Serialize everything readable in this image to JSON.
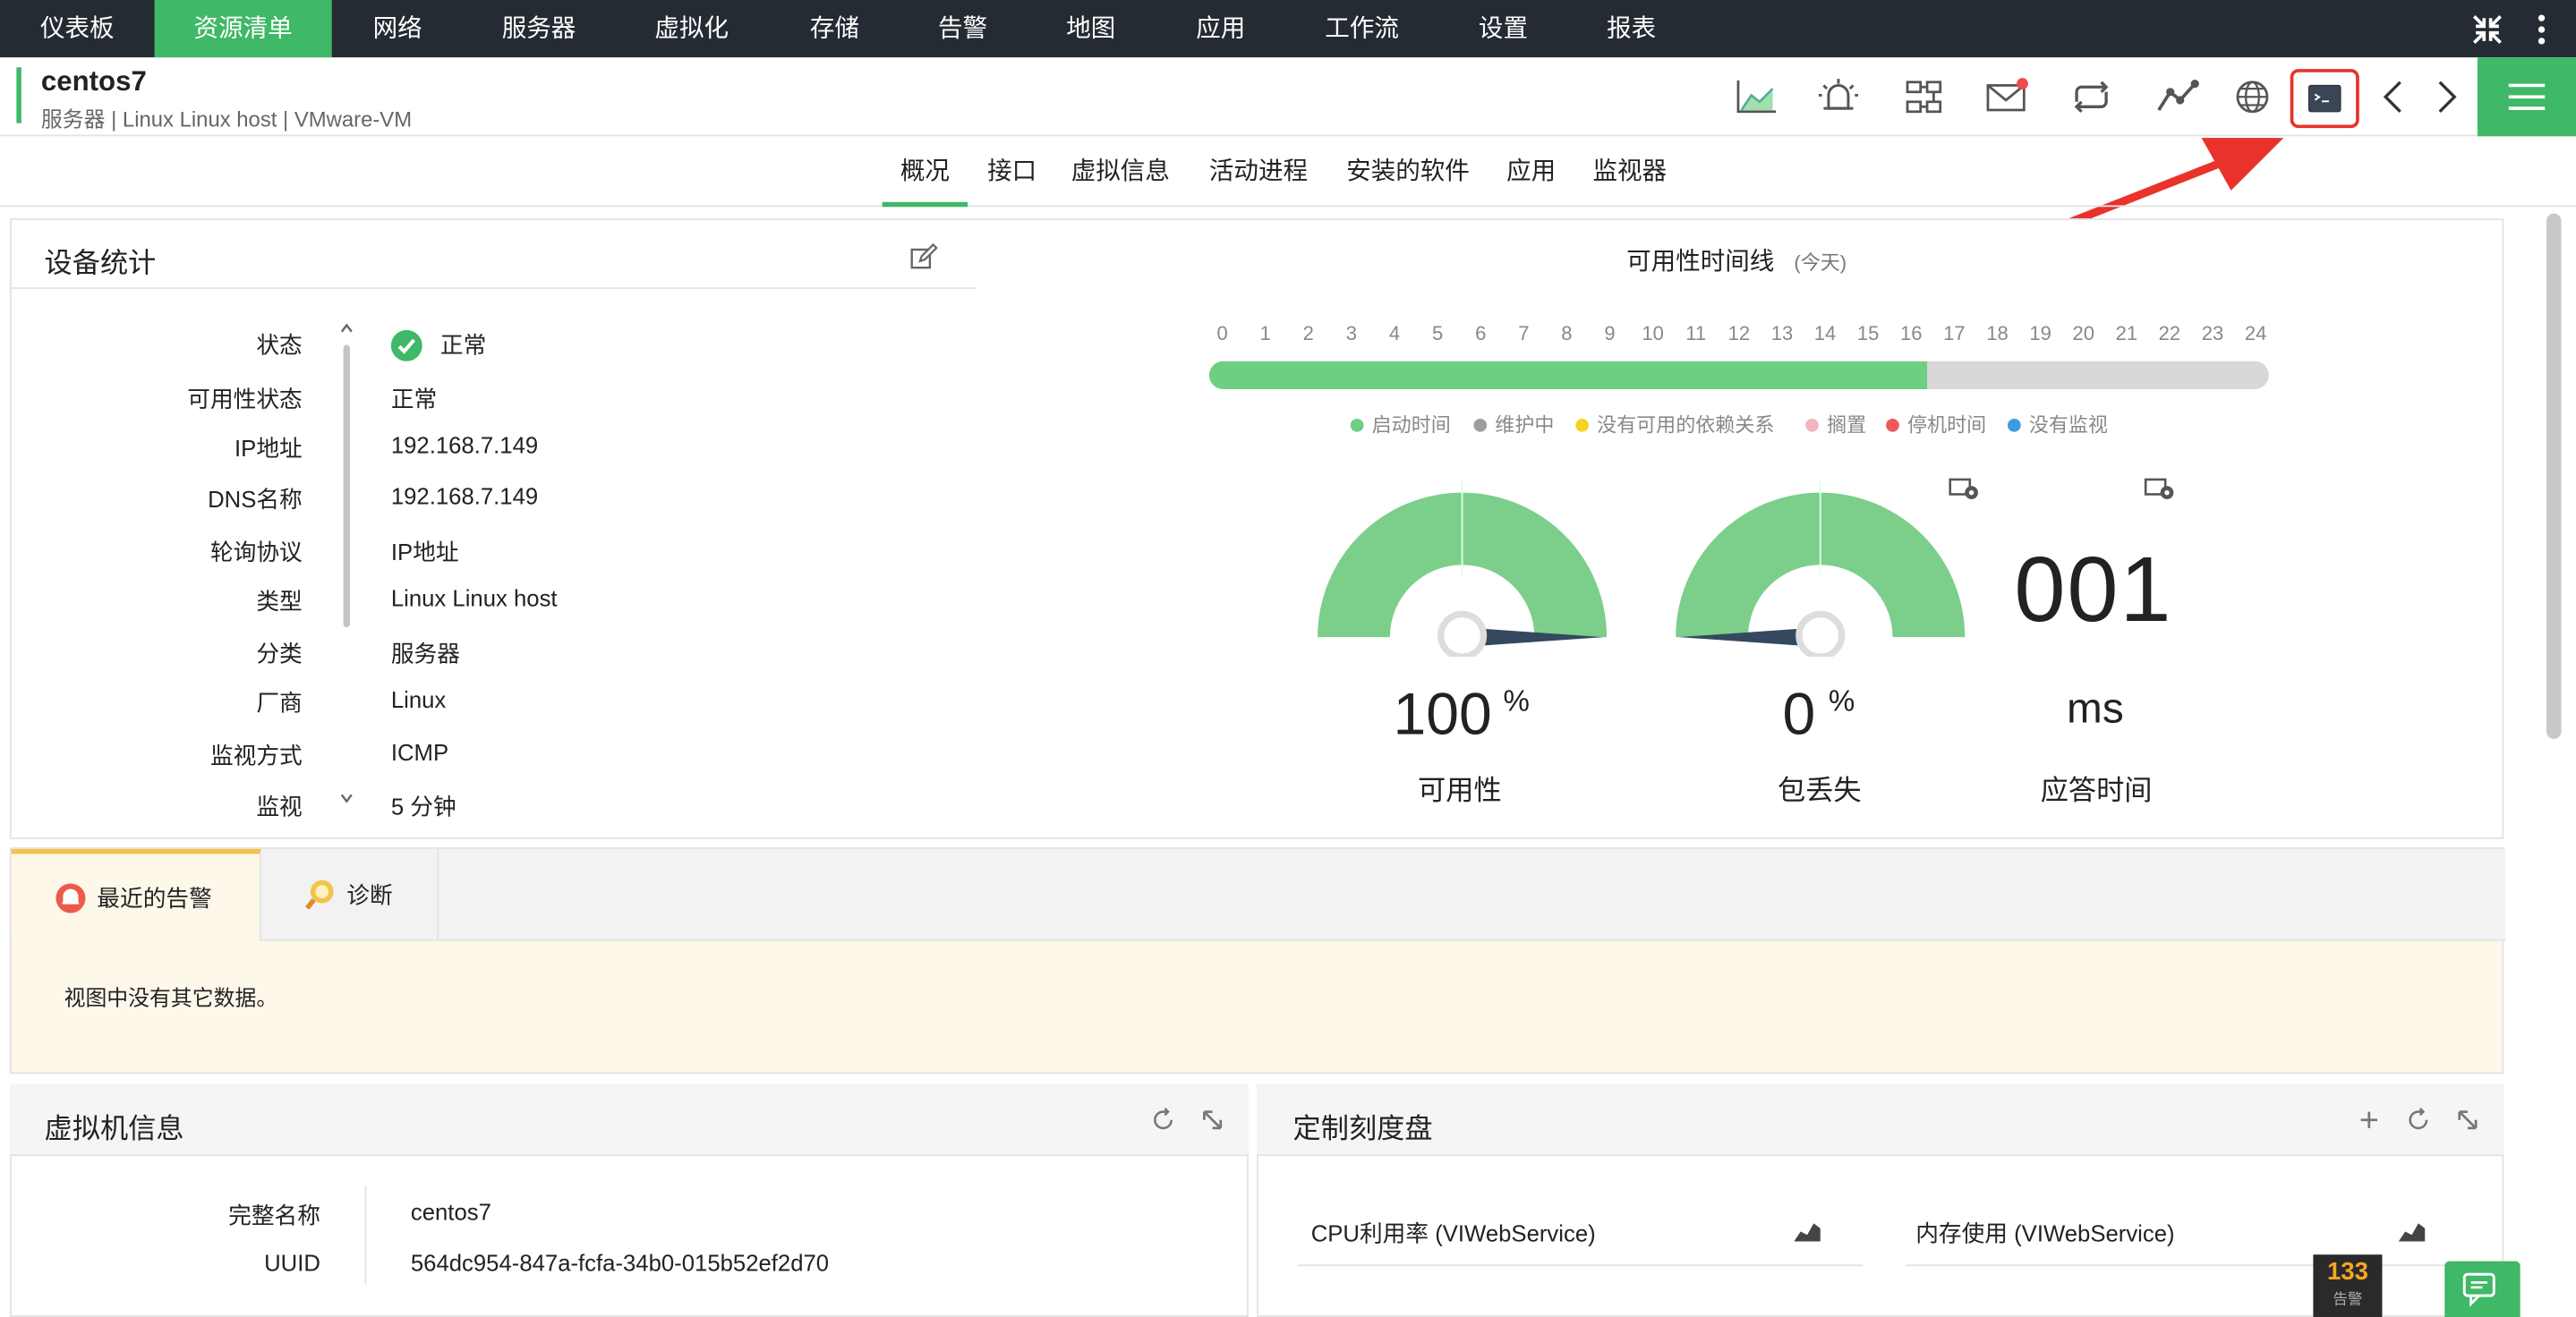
{
  "nav": {
    "items": [
      "仪表板",
      "资源清单",
      "网络",
      "服务器",
      "虚拟化",
      "存储",
      "告警",
      "地图",
      "应用",
      "工作流",
      "设置",
      "报表"
    ],
    "active_index": 1
  },
  "device": {
    "name": "centos7",
    "subtitle": "服务器 | Linux Linux host | VMware-VM"
  },
  "tabs": [
    "概况",
    "接口",
    "虚拟信息",
    "活动进程",
    "安装的软件",
    "应用",
    "监视器"
  ],
  "stats": {
    "title": "设备统计",
    "rows": [
      {
        "label": "状态",
        "value": "正常"
      },
      {
        "label": "可用性状态",
        "value": "正常"
      },
      {
        "label": "IP地址",
        "value": "192.168.7.149"
      },
      {
        "label": "DNS名称",
        "value": "192.168.7.149"
      },
      {
        "label": "轮询协议",
        "value": "IP地址"
      },
      {
        "label": "类型",
        "value": "Linux Linux host"
      },
      {
        "label": "分类",
        "value": "服务器"
      },
      {
        "label": "厂商",
        "value": "Linux"
      },
      {
        "label": "监视方式",
        "value": "ICMP"
      },
      {
        "label": "监视",
        "value": "5 分钟"
      }
    ]
  },
  "availability": {
    "title": "可用性时间线",
    "period": "(今天)",
    "hours": [
      "0",
      "1",
      "2",
      "3",
      "4",
      "5",
      "6",
      "7",
      "8",
      "9",
      "10",
      "11",
      "12",
      "13",
      "14",
      "15",
      "16",
      "17",
      "18",
      "19",
      "20",
      "21",
      "22",
      "23",
      "24"
    ],
    "uptime_fraction": 0.678,
    "legend": [
      {
        "label": "启动时间",
        "color": "#6ecf82"
      },
      {
        "label": "维护中",
        "color": "#9e9e9e"
      },
      {
        "label": "没有可用的依赖关系",
        "color": "#f5d31f"
      },
      {
        "label": "搁置",
        "color": "#f3b5c0"
      },
      {
        "label": "停机时间",
        "color": "#ee5a5a"
      },
      {
        "label": "没有监视",
        "color": "#3d9be0"
      }
    ]
  },
  "gauges": {
    "availability": {
      "value": "100",
      "unit": "%",
      "label": "可用性",
      "percent": 100
    },
    "packet_loss": {
      "value": "0",
      "unit": "%",
      "label": "包丢失",
      "percent": 0
    },
    "response": {
      "value": "001",
      "unit": "ms",
      "label": "应答时间"
    }
  },
  "alarms": {
    "tabs": [
      "最近的告警",
      "诊断"
    ],
    "empty_text": "视图中没有其它数据。"
  },
  "vm_info": {
    "title": "虚拟机信息",
    "rows": [
      {
        "label": "完整名称",
        "value": "centos7"
      },
      {
        "label": "UUID",
        "value": "564dc954-847a-fcfa-34b0-015b52ef2d70"
      }
    ]
  },
  "custom_dials": {
    "title": "定制刻度盘",
    "items": [
      "CPU利用率 (VIWebService)",
      "内存使用 (VIWebService)"
    ]
  },
  "footer": {
    "alarm_count": "133",
    "alarm_label": "告警"
  },
  "colors": {
    "accent": "#3fb867",
    "nav_bg": "#252b33",
    "annotation": "#e8322b"
  }
}
